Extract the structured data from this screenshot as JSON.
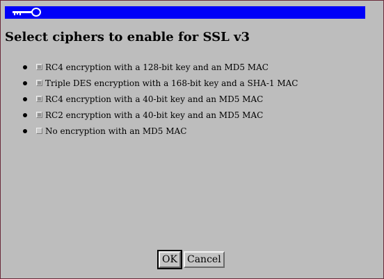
{
  "dialog": {
    "heading": "Select ciphers to enable for SSL v3",
    "key_icon": "key-icon",
    "titlebar_color": "#0000f8"
  },
  "ciphers": [
    {
      "label": "RC4 encryption with a 128-bit key and an MD5 MAC",
      "checked": true
    },
    {
      "label": "Triple DES encryption with a 168-bit key and a SHA-1 MAC",
      "checked": true
    },
    {
      "label": "RC4 encryption with a 40-bit key and an MD5 MAC",
      "checked": true
    },
    {
      "label": "RC2 encryption with a 40-bit key and an MD5 MAC",
      "checked": true
    },
    {
      "label": "No encryption with an MD5 MAC",
      "checked": false
    }
  ],
  "buttons": {
    "ok_label": "OK",
    "cancel_label": "Cancel"
  }
}
